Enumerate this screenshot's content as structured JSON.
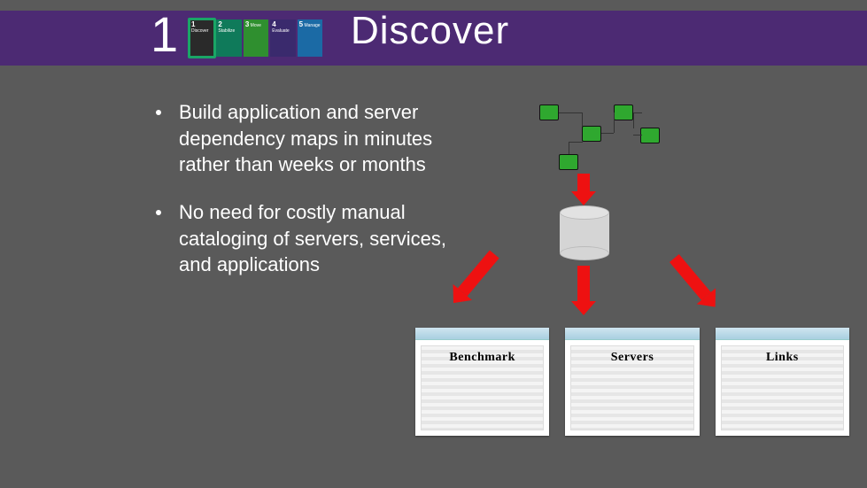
{
  "header": {
    "step_number": "1",
    "title": "Discover",
    "tiles": [
      {
        "num": "1",
        "name": "Discover"
      },
      {
        "num": "2",
        "name": "Stabilize"
      },
      {
        "num": "3",
        "name": "Move"
      },
      {
        "num": "4",
        "name": "Evaluate"
      },
      {
        "num": "5",
        "name": "Manage"
      }
    ]
  },
  "bullets": [
    "Build application and server dependency maps in minutes rather than weeks or months",
    "No need for costly manual cataloging of servers, services, and applications"
  ],
  "outputs": [
    {
      "label": "Benchmark"
    },
    {
      "label": "Servers"
    },
    {
      "label": "Links"
    }
  ]
}
